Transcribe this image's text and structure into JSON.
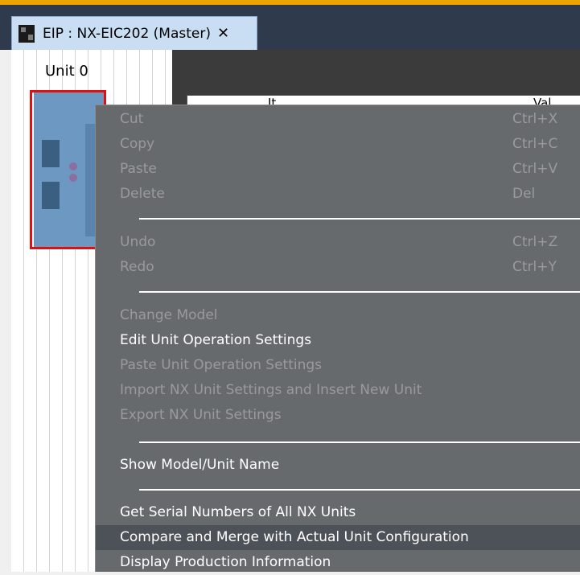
{
  "tab": {
    "title": "EIP : NX-EIC202 (Master)",
    "close": "✕"
  },
  "unit": {
    "label": "Unit 0"
  },
  "table": {
    "col1": "It",
    "col2": "Val"
  },
  "menu": {
    "cut": {
      "label": "Cut",
      "shortcut": "Ctrl+X"
    },
    "copy": {
      "label": "Copy",
      "shortcut": "Ctrl+C"
    },
    "paste": {
      "label": "Paste",
      "shortcut": "Ctrl+V"
    },
    "delete": {
      "label": "Delete",
      "shortcut": "Del"
    },
    "undo": {
      "label": "Undo",
      "shortcut": "Ctrl+Z"
    },
    "redo": {
      "label": "Redo",
      "shortcut": "Ctrl+Y"
    },
    "change_model": {
      "label": "Change Model"
    },
    "edit_settings": {
      "label": "Edit Unit Operation Settings"
    },
    "paste_settings": {
      "label": "Paste Unit Operation Settings"
    },
    "import_settings": {
      "label": "Import NX Unit Settings and Insert New Unit"
    },
    "export_settings": {
      "label": "Export NX Unit Settings"
    },
    "show_model": {
      "label": "Show Model/Unit Name"
    },
    "get_serial": {
      "label": "Get Serial Numbers of All NX Units"
    },
    "compare_merge": {
      "label": "Compare and Merge with Actual Unit Configuration"
    },
    "display_production": {
      "label": "Display Production Information"
    }
  }
}
